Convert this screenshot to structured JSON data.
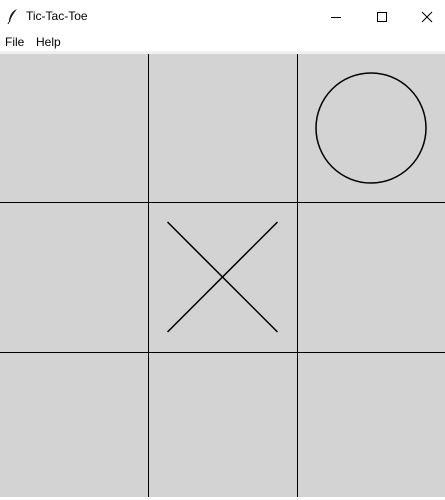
{
  "window": {
    "title": "Tic-Tac-Toe",
    "icon": "feather-icon",
    "controls": [
      "minimize-icon",
      "maximize-icon",
      "close-icon"
    ]
  },
  "menu": {
    "items": [
      {
        "label": "File"
      },
      {
        "label": "Help"
      }
    ]
  },
  "board": {
    "background": "#d3d3d3",
    "line_color": "#000000",
    "cells": [
      "",
      "",
      "O",
      "",
      "X",
      "",
      "",
      "",
      ""
    ]
  }
}
